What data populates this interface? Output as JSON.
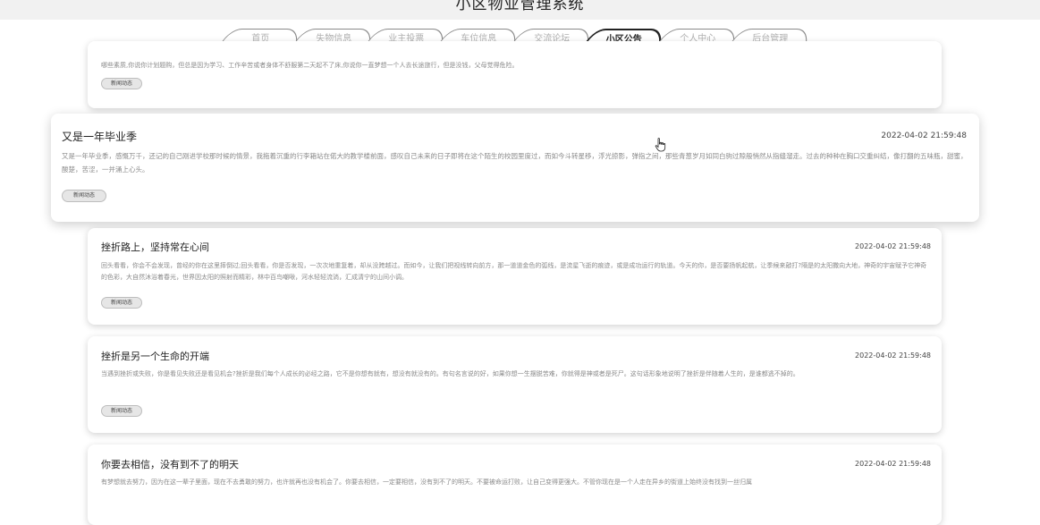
{
  "header": {
    "title": "小区物业管理系统"
  },
  "nav": {
    "tabs": [
      {
        "label": "首页"
      },
      {
        "label": "失物信息"
      },
      {
        "label": "业主投票"
      },
      {
        "label": "车位信息"
      },
      {
        "label": "交流论坛"
      },
      {
        "label": "小区公告",
        "active": true
      },
      {
        "label": "个人中心"
      },
      {
        "label": "后台管理"
      }
    ]
  },
  "notices": [
    {
      "title": "",
      "date": "",
      "body": "哪些素质,你说你计划题购，但总是因为学习、工作辛苦或者身体不舒服第二天起不了床,你说你一直梦想一个人去长途旅行，但是没钱，父母觉得危险。",
      "tag": "新闻动态"
    },
    {
      "title": "又是一年毕业季",
      "date": "2022-04-02 21:59:48",
      "body": "又是一年毕业季，感慨万千，还记的自己刚进学校那时候的情景，我拖着沉重的行李箱站在偌大的教学楼前面，感叹自己未来的日子即将在这个陌生的校园里度过，而如今斗转星移，浮光掠影，弹指之间，那些青葱岁月如同白驹过隙般悄然从指缝溜走。过去的种种在胸口交重纠结，像打翻的五味瓶，甜蜜，酸楚，苦涩，一并涌上心头。",
      "tag": "新闻动态"
    },
    {
      "title": "挫折路上，坚持常在心间",
      "date": "2022-04-02 21:59:48",
      "body": "回头看看，你会不会发现，曾经的你在这里摔倒过;回头看看，你是否发现，一次次地重复着，却从没跨越过。而如今，让我们把视线转向前方，那一道道金色的弧线，是流星飞逝的痕迹，或是成功运行的轨道。今天的你，是否要扬帆起航，让季候来敲打?隔是的太阳撒向大地，神奇的宇宙赋予它神奇的色彩，大自然沐浴着春光，世界因太阳的照射而精彩，林中百鸟嘲啾，河水轻轻流淌，汇成清宁的山间小调。",
      "tag": "新闻动态"
    },
    {
      "title": "挫折是另一个生命的开端",
      "date": "2022-04-02 21:59:48",
      "body": "当遇到挫折或失败，你是看见失败还是看见机会?挫折是我们每个人成长的必经之路，它不是你想有就有，想没有就没有的。有句名言说的好，如果你想一生摆脱苦难，你就得是神或者是死尸。这句话形象地说明了挫折是伴随着人生的，是谁都逃不掉的。",
      "tag": "新闻动态"
    },
    {
      "title": "你要去相信，没有到不了的明天",
      "date": "2022-04-02 21:59:48",
      "body": "有梦想就去努力，因为在这一辈子里面，现在不去勇敢的努力，也许就再也没有机会了。你要去相信，一定要相信，没有到不了的明天。不要被命运打败，让自己变得更强大。不管你现在是一个人走在异乡的街道上始终没有找到一丝归属",
      "tag": ""
    }
  ]
}
